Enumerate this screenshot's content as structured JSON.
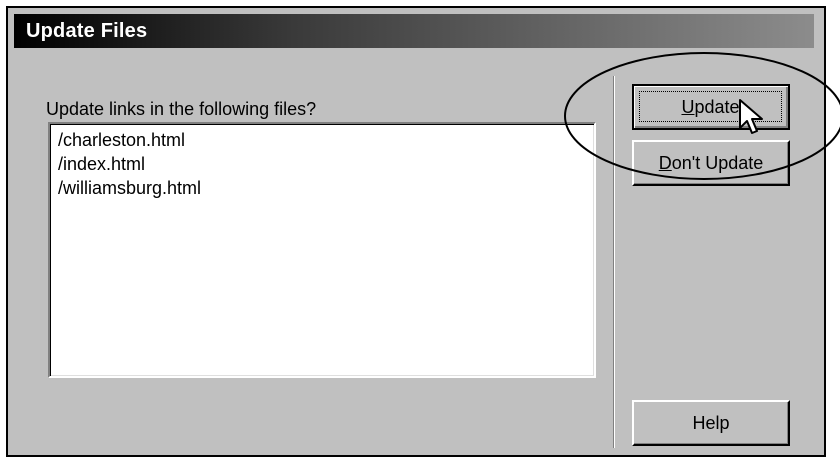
{
  "dialog": {
    "title": "Update Files",
    "prompt": "Update links in the following files?",
    "files": [
      "/charleston.html",
      "/index.html",
      "/williamsburg.html"
    ]
  },
  "buttons": {
    "update": {
      "label": "Update",
      "mnemonic": "U",
      "rest": "pdate"
    },
    "dont_update": {
      "label": "Don't Update",
      "mnemonic": "D",
      "rest": "on't Update"
    },
    "help": {
      "label": "Help"
    }
  },
  "colors": {
    "dialog_face": "#c0c0c0",
    "title_gradient_start": "#000000",
    "title_gradient_end": "#8c8c8c",
    "listbox_bg": "#ffffff"
  },
  "icons": {
    "pointer": "arrow-cursor-icon",
    "callout": "highlight-ellipse"
  }
}
